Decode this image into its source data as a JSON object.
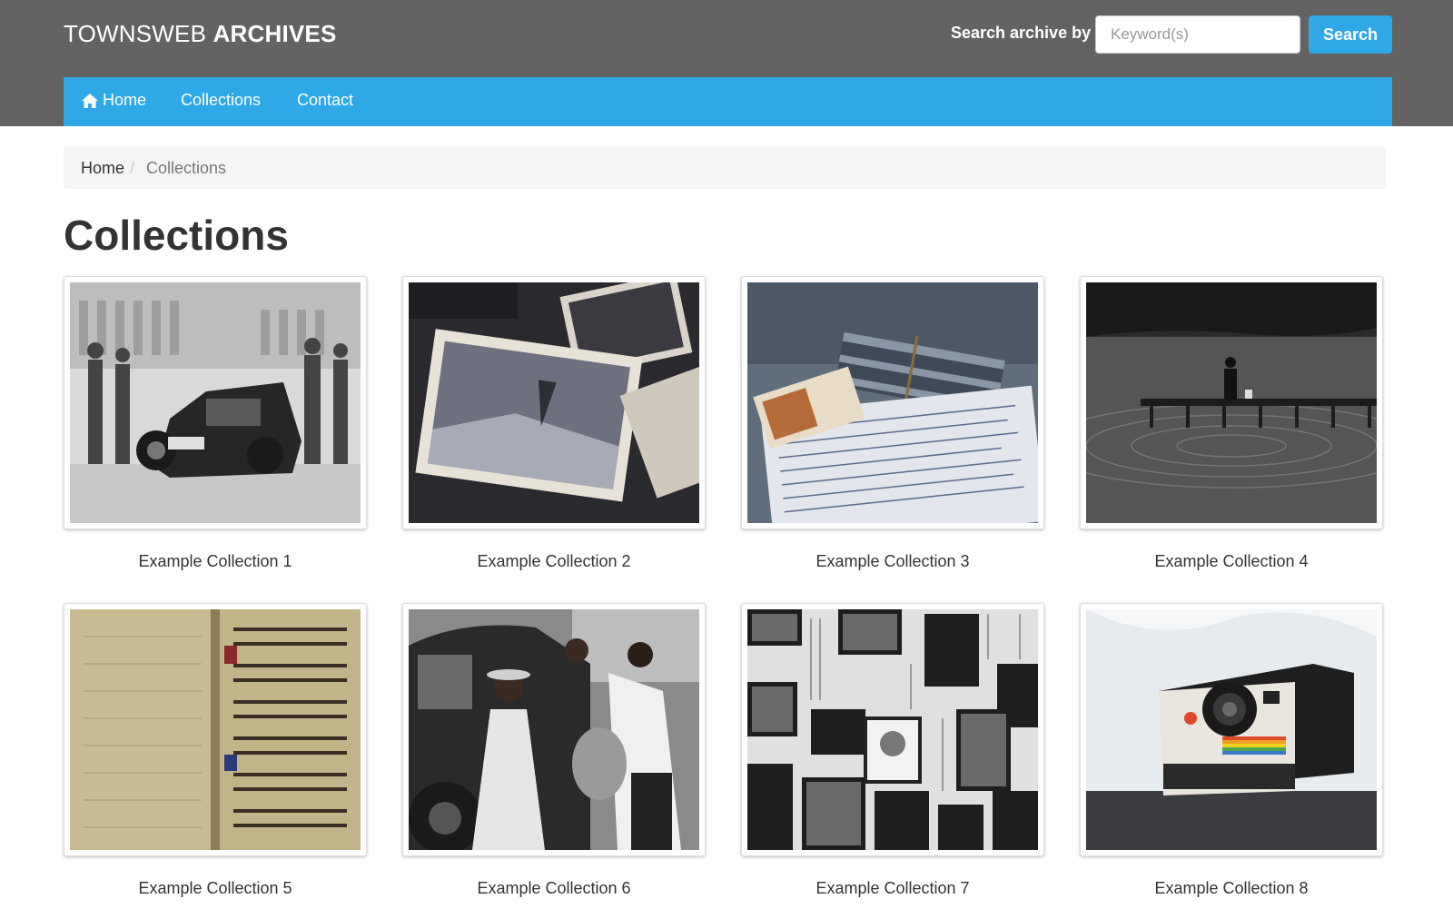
{
  "header": {
    "brand_regular": "TOWNSWEB",
    "brand_bold": "ARCHIVES",
    "search_label": "Search archive by",
    "search_placeholder": "Keyword(s)",
    "search_value": "",
    "search_button": "Search",
    "colors": {
      "header_bg": "#636363",
      "accent": "#2fa8e7"
    }
  },
  "nav": {
    "items": [
      {
        "label": "Home",
        "icon": "home-icon"
      },
      {
        "label": "Collections"
      },
      {
        "label": "Contact"
      }
    ]
  },
  "breadcrumb": {
    "home": "Home",
    "separator": "/",
    "current": "Collections"
  },
  "page": {
    "title": "Collections"
  },
  "collections": [
    {
      "title": "Example Collection 1",
      "image": "vintage car accident photo"
    },
    {
      "title": "Example Collection 2",
      "image": "pile of old photographs"
    },
    {
      "title": "Example Collection 3",
      "image": "bundle of letters"
    },
    {
      "title": "Example Collection 4",
      "image": "person on pier at lake"
    },
    {
      "title": "Example Collection 5",
      "image": "medieval manuscript book"
    },
    {
      "title": "Example Collection 6",
      "image": "people beside vintage car"
    },
    {
      "title": "Example Collection 7",
      "image": "wall of speakers and records"
    },
    {
      "title": "Example Collection 8",
      "image": "instant camera"
    }
  ]
}
